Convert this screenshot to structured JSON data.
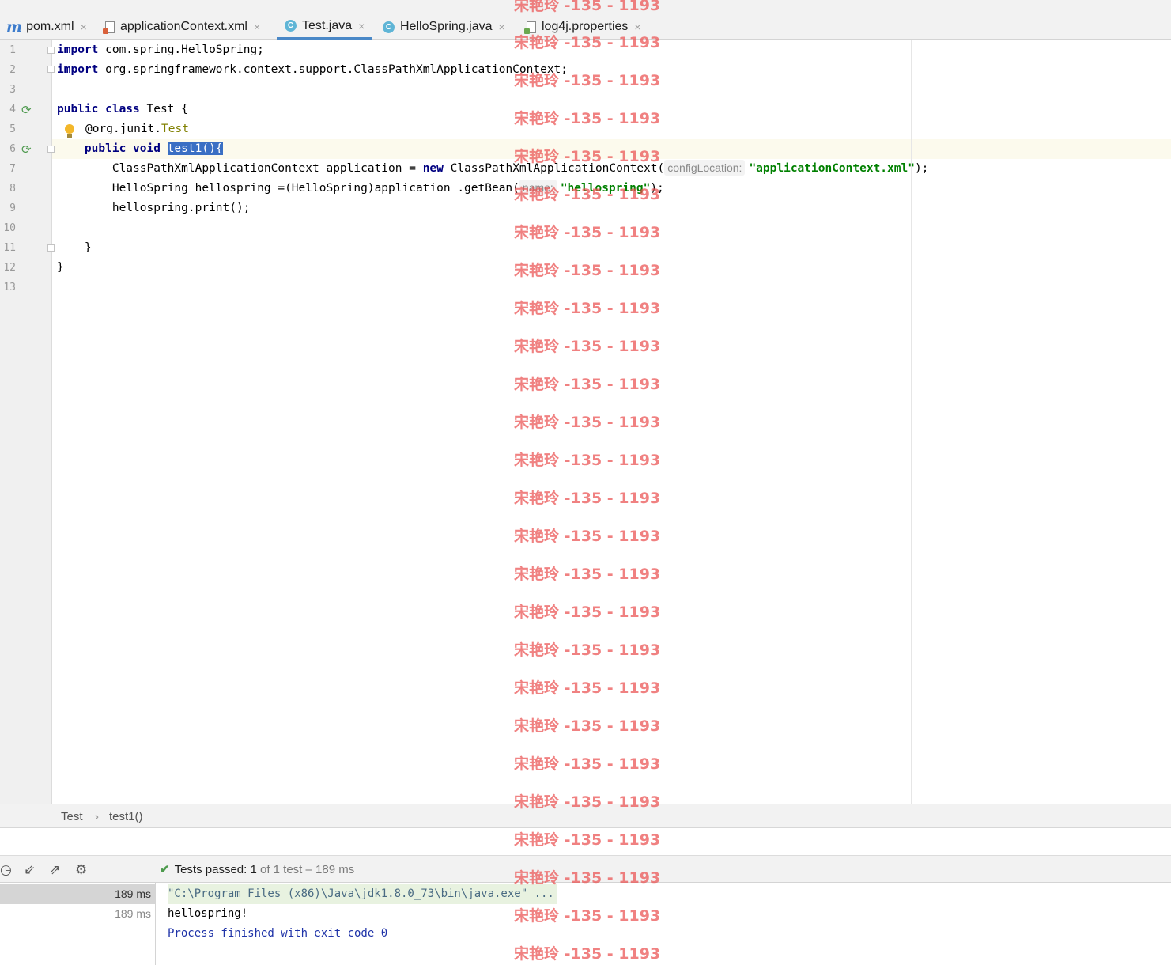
{
  "tabs": [
    {
      "label": "pom.xml",
      "icon": "maven-icon",
      "active": false
    },
    {
      "label": "applicationContext.xml",
      "icon": "xml-file-icon",
      "active": false
    },
    {
      "label": "Test.java",
      "icon": "java-class-icon",
      "active": true
    },
    {
      "label": "HelloSpring.java",
      "icon": "java-class-icon",
      "active": false
    },
    {
      "label": "log4j.properties",
      "icon": "properties-file-icon",
      "active": false
    }
  ],
  "tab_close_glyph": "×",
  "line_numbers": [
    "1",
    "2",
    "3",
    "4",
    "5",
    "6",
    "7",
    "8",
    "9",
    "10",
    "11",
    "12",
    "13"
  ],
  "code": {
    "l1_kw": "import",
    "l1_rest": " com.spring.HelloSpring;",
    "l2_kw": "import",
    "l2_rest": " org.springframework.context.support.ClassPathXmlApplicationContext;",
    "l4_kw": "public class",
    "l4_rest": " Test {",
    "l5_ann": "@org.junit.",
    "l5_type": "Test",
    "l6_kw": "    public void ",
    "l6_sel": "test1(){",
    "l7_a": "        ClassPathXmlApplicationContext application = ",
    "l7_kw": "new",
    "l7_b": " ClassPathXmlApplicationContext(",
    "l7_hint": "configLocation:",
    "l7_str": "\"applicationContext.xml\"",
    "l7_end": ");",
    "l8_a": "        HelloSpring hellospring =(HelloSpring)application .getBean(",
    "l8_hint": "name:",
    "l8_str": "\"hellospring\"",
    "l8_end": ");",
    "l9": "        hellospring.print();",
    "l11": "    }",
    "l12": "}"
  },
  "breadcrumb": [
    "Test",
    "test1()"
  ],
  "breadcrumb_sep": "›",
  "run": {
    "status_label": "Tests passed:",
    "status_count": "1",
    "status_detail": "of 1 test – 189 ms",
    "tree_times": [
      "189 ms",
      "189 ms"
    ],
    "output": [
      "\"C:\\Program Files (x86)\\Java\\jdk1.8.0_73\\bin\\java.exe\" ...",
      "hellospring!",
      "Process finished with exit code 0"
    ]
  },
  "watermark": "宋艳玲 -135 - 1193",
  "colors": {
    "keyword": "#000080",
    "string": "#008000",
    "annotation": "#808000",
    "selection": "#3a6fc4",
    "watermark": "#ea5050"
  }
}
